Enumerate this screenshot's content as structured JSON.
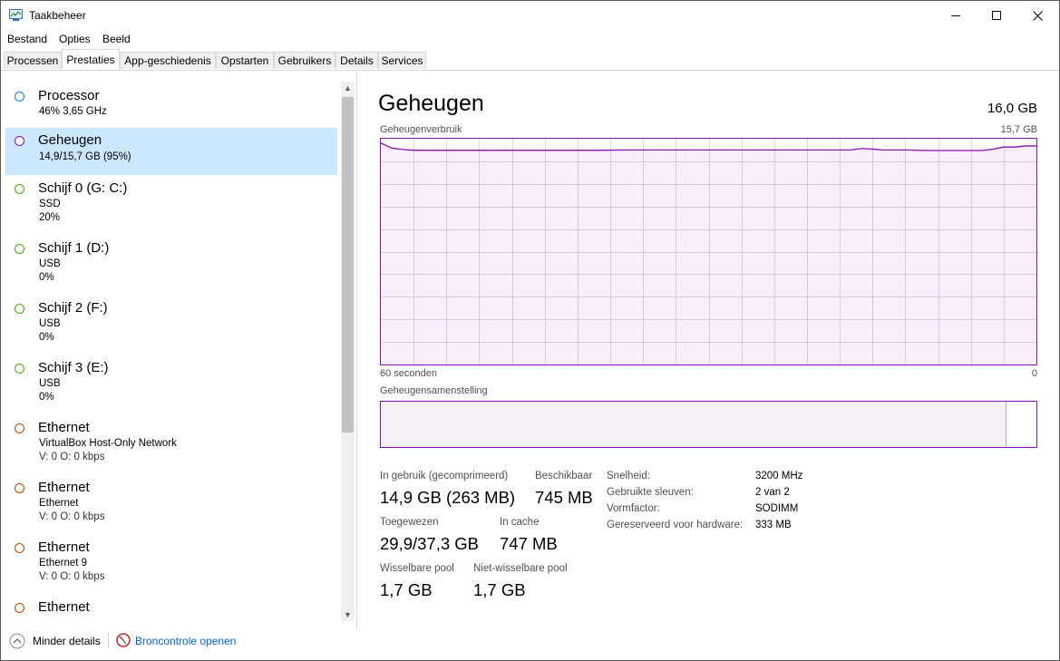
{
  "window": {
    "title": "Taakbeheer"
  },
  "menu": [
    "Bestand",
    "Opties",
    "Beeld"
  ],
  "tabs": [
    "Processen",
    "Prestaties",
    "App-geschiedenis",
    "Opstarten",
    "Gebruikers",
    "Details",
    "Services"
  ],
  "active_tab": "Prestaties",
  "sidebar": {
    "items": [
      {
        "name": "Processor",
        "lines": [
          "46% 3,65 GHz"
        ],
        "color": "#1a7bc4",
        "selected": false
      },
      {
        "name": "Geheugen",
        "lines": [
          "14,9/15,7 GB (95%)"
        ],
        "color": "#8b12ae",
        "selected": true
      },
      {
        "name": "Schijf 0 (G: C:)",
        "lines": [
          "SSD",
          "20%"
        ],
        "color": "#4da60c",
        "selected": false
      },
      {
        "name": "Schijf 1 (D:)",
        "lines": [
          "USB",
          "0%"
        ],
        "color": "#4da60c",
        "selected": false
      },
      {
        "name": "Schijf 2 (F:)",
        "lines": [
          "USB",
          "0%"
        ],
        "color": "#4da60c",
        "selected": false
      },
      {
        "name": "Schijf 3 (E:)",
        "lines": [
          "USB",
          "0%"
        ],
        "color": "#4da60c",
        "selected": false
      },
      {
        "name": "Ethernet",
        "lines": [
          "VirtualBox Host-Only Network",
          "V: 0 O: 0 kbps"
        ],
        "color": "#a74f01",
        "selected": false
      },
      {
        "name": "Ethernet",
        "lines": [
          "Ethernet",
          "V: 0 O: 0 kbps"
        ],
        "color": "#a74f01",
        "selected": false
      },
      {
        "name": "Ethernet",
        "lines": [
          "Ethernet 9",
          "V: 0 O: 0 kbps"
        ],
        "color": "#a74f01",
        "selected": false
      },
      {
        "name": "Ethernet",
        "lines": [],
        "color": "#a74f01",
        "selected": false
      }
    ]
  },
  "memory": {
    "title": "Geheugen",
    "total": "16,0 GB",
    "usage_graph": {
      "label": "Geheugenverbruik",
      "max_label": "15,7 GB",
      "time_left_label": "60 seconden",
      "time_right_label": "0",
      "color": "#8b12ae"
    },
    "composition": {
      "label": "Geheugensamenstelling",
      "in_use_fraction": 0.953
    },
    "stats": {
      "in_use_label": "In gebruik (gecomprimeerd)",
      "in_use_value": "14,9 GB (263 MB)",
      "available_label": "Beschikbaar",
      "available_value": "745 MB",
      "committed_label": "Toegewezen",
      "committed_value": "29,9/37,3 GB",
      "cached_label": "In cache",
      "cached_value": "747 MB",
      "paged_label": "Wisselbare pool",
      "paged_value": "1,7 GB",
      "nonpaged_label": "Niet-wisselbare pool",
      "nonpaged_value": "1,7 GB"
    },
    "specs": [
      {
        "label": "Snelheid:",
        "value": "3200 MHz"
      },
      {
        "label": "Gebruikte sleuven:",
        "value": "2 van 2"
      },
      {
        "label": "Vormfactor:",
        "value": "SODIMM"
      },
      {
        "label": "Gereserveerd voor hardware:",
        "value": "333 MB"
      }
    ]
  },
  "chart_data": {
    "type": "area",
    "x": [
      60,
      59,
      58,
      57,
      55,
      50,
      45,
      40,
      37,
      35,
      30,
      25,
      20,
      17,
      16,
      15,
      14,
      12,
      10,
      8,
      5,
      4,
      3,
      2,
      1,
      0
    ],
    "values": [
      15.4,
      15.05,
      14.95,
      14.9,
      14.9,
      14.9,
      14.9,
      14.9,
      14.92,
      14.92,
      14.92,
      14.92,
      14.92,
      14.92,
      15.02,
      14.98,
      14.92,
      14.92,
      14.88,
      14.88,
      14.88,
      14.97,
      15.12,
      15.12,
      15.2,
      15.2
    ],
    "ylim": [
      0,
      15.7
    ],
    "xlim": [
      60,
      0
    ]
  },
  "footer": {
    "fewer_details": "Minder details",
    "resource_monitor": "Broncontrole openen"
  }
}
